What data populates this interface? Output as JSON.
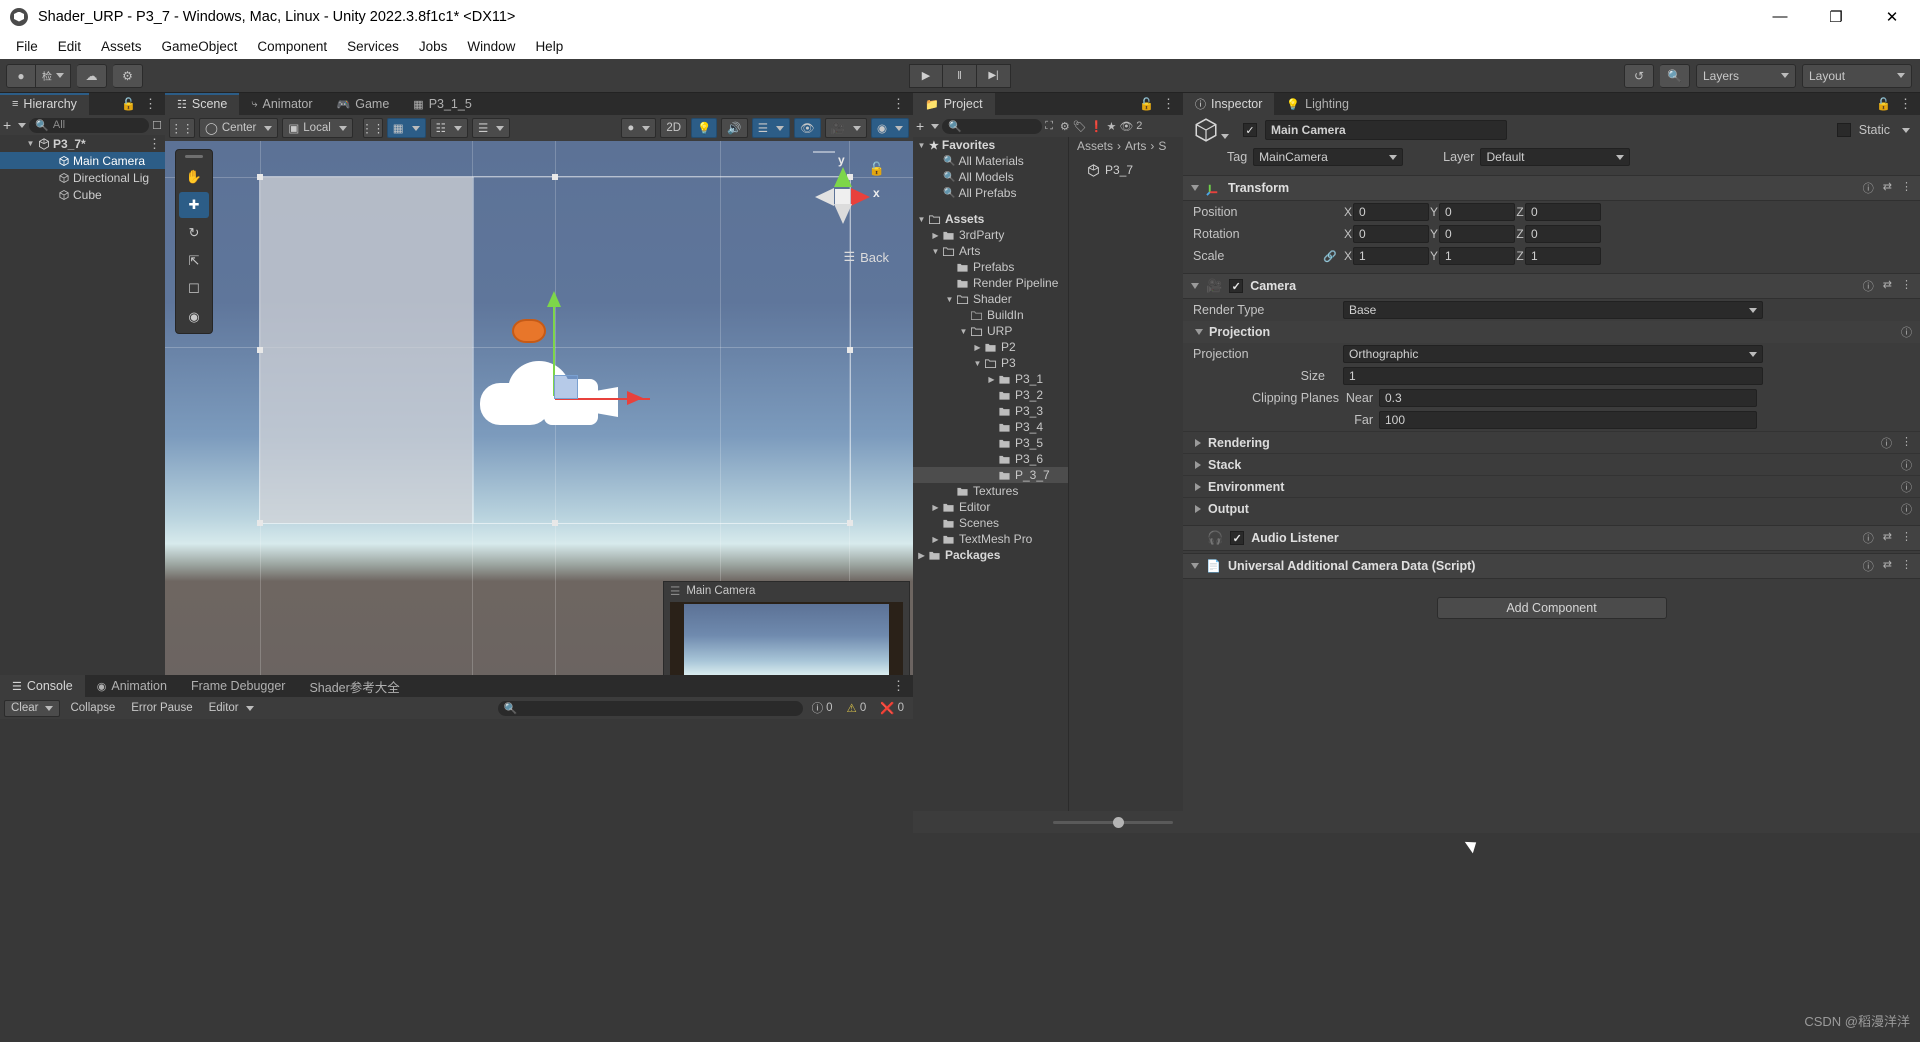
{
  "window": {
    "title": "Shader_URP - P3_7 - Windows, Mac, Linux - Unity 2022.3.8f1c1* <DX11>",
    "minimize": "—",
    "maximize": "❐",
    "close": "✕"
  },
  "menubar": [
    "File",
    "Edit",
    "Assets",
    "GameObject",
    "Component",
    "Services",
    "Jobs",
    "Window",
    "Help"
  ],
  "toolbar": {
    "account_label": "▼",
    "cloud_icon": "cloud-icon",
    "settings_icon": "gear-icon",
    "play": "▶",
    "pause": "‖",
    "step": "▶|",
    "history_icon": "undo-history-icon",
    "search_icon": "search-icon",
    "layers_label": "Layers",
    "layout_label": "Layout"
  },
  "hierarchy": {
    "tab": "Hierarchy",
    "add_label": "+",
    "search_placeholder": "All",
    "items": [
      {
        "label": "P3_7*",
        "depth": 0,
        "icon": "unity-scene-icon",
        "expanded": true,
        "selected": false
      },
      {
        "label": "Main Camera",
        "depth": 1,
        "icon": "gameobject-icon",
        "expanded": false,
        "selected": true
      },
      {
        "label": "Directional Lig",
        "depth": 1,
        "icon": "gameobject-icon",
        "expanded": false,
        "selected": false
      },
      {
        "label": "Cube",
        "depth": 1,
        "icon": "gameobject-icon",
        "expanded": false,
        "selected": false
      }
    ]
  },
  "scene": {
    "tabs": [
      {
        "label": "Scene",
        "icon": "grid-icon",
        "active": true
      },
      {
        "label": "Animator",
        "icon": "animator-icon",
        "active": false
      },
      {
        "label": "Game",
        "icon": "gamepad-icon",
        "active": false
      },
      {
        "label": "P3_1_5",
        "icon": "shadergraph-icon",
        "active": false
      }
    ],
    "toolbar": {
      "pivot_label": "Center",
      "handle_label": "Local",
      "grid_icon": "grid-snap-icon",
      "snap_icon": "snap-increment-icon",
      "ruler_icon": "ruler-icon",
      "shading_icon": "shading-mode-icon",
      "twod_label": "2D",
      "light_icon": "lighting-icon",
      "audio_icon": "audio-icon",
      "fx_icon": "effects-icon",
      "hidden_icon": "visibility-icon",
      "camera_icon": "scene-camera-icon",
      "gizmos_icon": "gizmos-icon"
    },
    "overlay_tools": [
      "hand-tool",
      "move-tool",
      "rotate-tool",
      "scale-tool",
      "rect-tool",
      "transform-tool"
    ],
    "gizmo": {
      "x_label": "x",
      "y_label": "y",
      "view_label": "Back"
    },
    "camera_preview": {
      "title": "Main Camera"
    }
  },
  "project": {
    "tab": "Project",
    "add_label": "+",
    "search_placeholder": "",
    "hidden_count": "2",
    "breadcrumb": [
      "Assets",
      "Arts",
      "S"
    ],
    "breadcrumb_sep": "›",
    "asset_item": "P3_7",
    "tree": [
      {
        "label": "Favorites",
        "depth": 0,
        "type": "star",
        "expanded": true,
        "bold": true,
        "selected": false
      },
      {
        "label": "All Materials",
        "depth": 1,
        "type": "search",
        "expanded": null,
        "bold": false,
        "selected": false
      },
      {
        "label": "All Models",
        "depth": 1,
        "type": "search",
        "expanded": null,
        "bold": false,
        "selected": false
      },
      {
        "label": "All Prefabs",
        "depth": 1,
        "type": "search",
        "expanded": null,
        "bold": false,
        "selected": false
      },
      {
        "label": "",
        "depth": 0,
        "type": "spacer",
        "expanded": null,
        "bold": false,
        "selected": false
      },
      {
        "label": "Assets",
        "depth": 0,
        "type": "folder-open",
        "expanded": true,
        "bold": true,
        "selected": false
      },
      {
        "label": "3rdParty",
        "depth": 1,
        "type": "folder",
        "expanded": false,
        "bold": false,
        "selected": false
      },
      {
        "label": "Arts",
        "depth": 1,
        "type": "folder-open",
        "expanded": true,
        "bold": false,
        "selected": false
      },
      {
        "label": "Prefabs",
        "depth": 2,
        "type": "folder",
        "expanded": null,
        "bold": false,
        "selected": false
      },
      {
        "label": "Render Pipeline",
        "depth": 2,
        "type": "folder",
        "expanded": null,
        "bold": false,
        "selected": false
      },
      {
        "label": "Shader",
        "depth": 2,
        "type": "folder-open",
        "expanded": true,
        "bold": false,
        "selected": false
      },
      {
        "label": "BuildIn",
        "depth": 3,
        "type": "folder-empty",
        "expanded": null,
        "bold": false,
        "selected": false
      },
      {
        "label": "URP",
        "depth": 3,
        "type": "folder-open",
        "expanded": true,
        "bold": false,
        "selected": false
      },
      {
        "label": "P2",
        "depth": 4,
        "type": "folder",
        "expanded": false,
        "bold": false,
        "selected": false
      },
      {
        "label": "P3",
        "depth": 4,
        "type": "folder-open",
        "expanded": true,
        "bold": false,
        "selected": false
      },
      {
        "label": "P3_1",
        "depth": 5,
        "type": "folder",
        "expanded": false,
        "bold": false,
        "selected": false
      },
      {
        "label": "P3_2",
        "depth": 5,
        "type": "folder",
        "expanded": null,
        "bold": false,
        "selected": false
      },
      {
        "label": "P3_3",
        "depth": 5,
        "type": "folder",
        "expanded": null,
        "bold": false,
        "selected": false
      },
      {
        "label": "P3_4",
        "depth": 5,
        "type": "folder",
        "expanded": null,
        "bold": false,
        "selected": false
      },
      {
        "label": "P3_5",
        "depth": 5,
        "type": "folder",
        "expanded": null,
        "bold": false,
        "selected": false
      },
      {
        "label": "P3_6",
        "depth": 5,
        "type": "folder",
        "expanded": null,
        "bold": false,
        "selected": false
      },
      {
        "label": "P_3_7",
        "depth": 5,
        "type": "folder",
        "expanded": null,
        "bold": false,
        "selected": true
      },
      {
        "label": "Textures",
        "depth": 2,
        "type": "folder",
        "expanded": null,
        "bold": false,
        "selected": false
      },
      {
        "label": "Editor",
        "depth": 1,
        "type": "folder",
        "expanded": false,
        "bold": false,
        "selected": false
      },
      {
        "label": "Scenes",
        "depth": 1,
        "type": "folder",
        "expanded": null,
        "bold": false,
        "selected": false
      },
      {
        "label": "TextMesh Pro",
        "depth": 1,
        "type": "folder",
        "expanded": false,
        "bold": false,
        "selected": false
      },
      {
        "label": "Packages",
        "depth": 0,
        "type": "folder",
        "expanded": false,
        "bold": true,
        "selected": false
      }
    ]
  },
  "inspector": {
    "tabs": [
      {
        "label": "Inspector",
        "icon": "info-icon",
        "active": true
      },
      {
        "label": "Lighting",
        "icon": "lighting-icon",
        "active": false
      }
    ],
    "object_name": "Main Camera",
    "object_enabled": true,
    "static_label": "Static",
    "tag_label": "Tag",
    "tag_value": "MainCamera",
    "layer_label": "Layer",
    "layer_value": "Default",
    "transform": {
      "title": "Transform",
      "rows": [
        {
          "label": "Position",
          "x": "0",
          "y": "0",
          "z": "0"
        },
        {
          "label": "Rotation",
          "x": "0",
          "y": "0",
          "z": "0"
        },
        {
          "label": "Scale",
          "x": "1",
          "y": "1",
          "z": "1"
        }
      ],
      "axis_labels": [
        "X",
        "Y",
        "Z"
      ]
    },
    "camera": {
      "title": "Camera",
      "enabled": true,
      "render_type_label": "Render Type",
      "render_type_value": "Base",
      "projection_title": "Projection",
      "projection_label": "Projection",
      "projection_value": "Orthographic",
      "size_label": "Size",
      "size_value": "1",
      "clipping_label": "Clipping Planes",
      "near_label": "Near",
      "near_value": "0.3",
      "far_label": "Far",
      "far_value": "100",
      "sections": [
        "Rendering",
        "Stack",
        "Environment",
        "Output"
      ]
    },
    "audio_listener": {
      "title": "Audio Listener",
      "enabled": true
    },
    "urp_data": {
      "title": "Universal Additional Camera Data (Script)"
    },
    "add_component": "Add Component"
  },
  "console": {
    "tabs": [
      {
        "label": "Console",
        "icon": "console-icon",
        "active": true
      },
      {
        "label": "Animation",
        "icon": "animation-icon",
        "active": false
      },
      {
        "label": "Frame Debugger",
        "icon": "",
        "active": false
      },
      {
        "label": "Shader参考大全",
        "icon": "",
        "active": false
      }
    ],
    "clear_label": "Clear",
    "collapse_label": "Collapse",
    "error_pause_label": "Error Pause",
    "editor_label": "Editor",
    "search_placeholder": "",
    "counts": {
      "log": "0",
      "warning": "0",
      "error": "0"
    }
  },
  "watermark": "CSDN @稻漫洋洋"
}
